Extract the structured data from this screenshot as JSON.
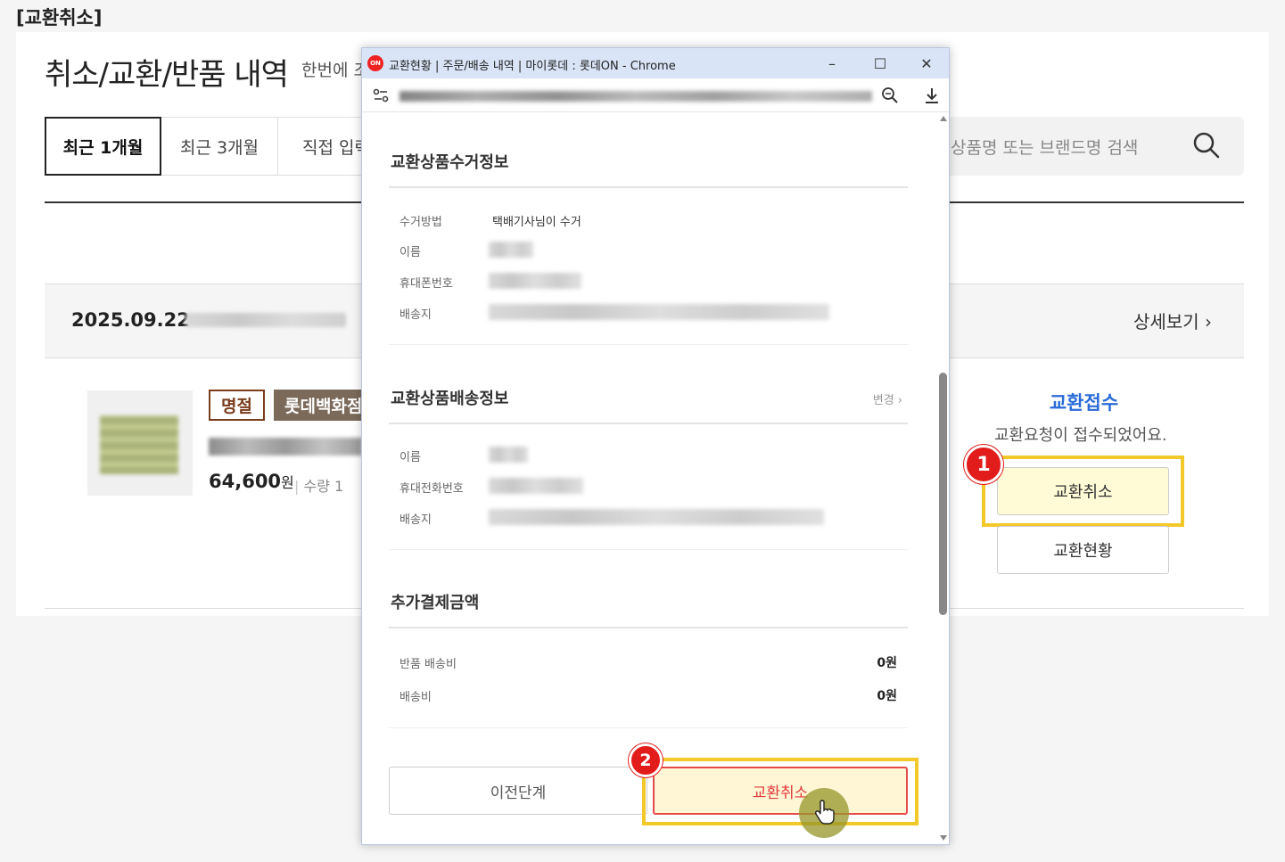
{
  "caption": "[교환취소]",
  "page": {
    "title": "취소/교환/반품 내역",
    "subtitle": "한번에 조",
    "period_tabs": [
      {
        "label": "최근 1개월",
        "active": true
      },
      {
        "label": "최근 3개월",
        "active": false
      },
      {
        "label": "직접 입력",
        "active": false
      }
    ],
    "search": {
      "placeholder": "상품명 또는 브랜드명 검색",
      "icon": "search-icon"
    },
    "order": {
      "date": "2025.09.22",
      "detail_label": "상세보기 ›",
      "badges": [
        "명절",
        "롯데백화점"
      ],
      "price": "64,600",
      "price_unit": "원",
      "qty": "수량 1",
      "status_title": "교환접수",
      "status_text": "교환요청이 접수되었어요.",
      "cancel_exchange_label": "교환취소",
      "exchange_status_label": "교환현황"
    }
  },
  "popup": {
    "window_title": "교환현황 | 주문/배송 내역 | 마이롯데 : 롯데ON - Chrome",
    "win_minimize": "–",
    "win_maximize": "☐",
    "win_close": "✕",
    "sections": {
      "pickup": {
        "title": "교환상품수거정보",
        "rows": [
          {
            "label": "수거방법",
            "value": "택배기사님이 수거"
          },
          {
            "label": "이름"
          },
          {
            "label": "휴대폰번호"
          },
          {
            "label": "배송지"
          }
        ]
      },
      "delivery": {
        "title": "교환상품배송정보",
        "change_label": "변경 ›",
        "rows": [
          {
            "label": "이름"
          },
          {
            "label": "휴대전화번호"
          },
          {
            "label": "배송지"
          }
        ]
      },
      "extra": {
        "title": "추가결제금액",
        "rows": [
          {
            "label": "반품 배송비",
            "value": "0원"
          },
          {
            "label": "배송비",
            "value": "0원"
          }
        ]
      }
    },
    "prev_label": "이전단계",
    "confirm_label": "교환취소"
  },
  "markers": [
    "1",
    "2"
  ],
  "colors": {
    "highlight": "#f3c829",
    "marker": "#e21b1b",
    "status_blue": "#2a6bd8",
    "confirm_red": "#e23b3b"
  }
}
